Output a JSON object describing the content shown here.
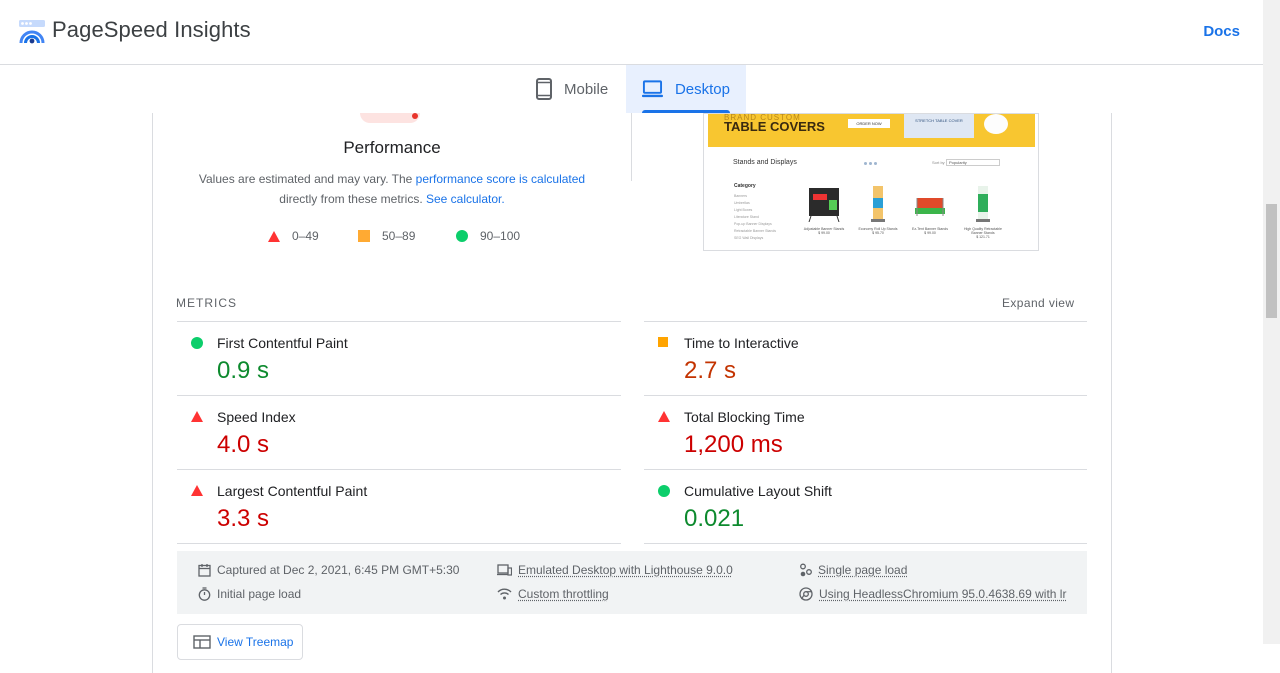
{
  "header": {
    "brand": "PageSpeed Insights",
    "docs_label": "Docs",
    "logo_icon": "pagespeed-logo-icon"
  },
  "tabs": [
    {
      "label": "Mobile",
      "icon": "mobile-phone-icon",
      "active": false
    },
    {
      "label": "Desktop",
      "icon": "laptop-icon",
      "active": true
    }
  ],
  "performance": {
    "title": "Performance",
    "desc_prefix": "Values are estimated and may vary. The ",
    "link_calculated": "performance score is calculated",
    "desc_middle": "directly from these metrics. ",
    "link_calculator": "See calculator.",
    "legend": [
      {
        "range": "0–49",
        "shape": "triangle",
        "color": "#ff3333"
      },
      {
        "range": "50–89",
        "shape": "square",
        "color": "#ffaa33"
      },
      {
        "range": "90–100",
        "shape": "circle",
        "color": "#0cce6b"
      }
    ]
  },
  "screenshot": {
    "banner_title": "TABLE COVERS",
    "banner_top": "BRAND CUSTOM",
    "banner_btn": "ORDER NOW",
    "banner_card": "STRETCH TABLE COVER",
    "section_title": "Stands and Displays",
    "sort_label": "Sort by",
    "sort_value": "Popularity",
    "category_title": "Category",
    "categories": [
      "Banners",
      "Umbrellas",
      "Light Boxes",
      "Literature Stand",
      "Pop-up Banner Displays",
      "Retractable Banner Stands",
      "SEG Wall Displays"
    ],
    "products": [
      {
        "name": "Adjustable Banner Stands",
        "price": "$ 99.00"
      },
      {
        "name": "Economy Roll Up Stands",
        "price": "$ 95.70"
      },
      {
        "name": "Ez-Tent Banner Stands",
        "price": "$ 99.00"
      },
      {
        "name": "High Quality Retractable Banner Stands",
        "price": "$ 121.71"
      }
    ]
  },
  "metrics": {
    "heading": "METRICS",
    "expand_label": "Expand view",
    "items": [
      {
        "label": "First Contentful Paint",
        "value": "0.9 s",
        "rating": "pass"
      },
      {
        "label": "Time to Interactive",
        "value": "2.7 s",
        "rating": "average"
      },
      {
        "label": "Speed Index",
        "value": "4.0 s",
        "rating": "fail"
      },
      {
        "label": "Total Blocking Time",
        "value": "1,200 ms",
        "rating": "fail"
      },
      {
        "label": "Largest Contentful Paint",
        "value": "3.3 s",
        "rating": "fail"
      },
      {
        "label": "Cumulative Layout Shift",
        "value": "0.021",
        "rating": "pass"
      }
    ]
  },
  "runtime": {
    "captured": "Captured at Dec 2, 2021, 6:45 PM GMT+5:30",
    "emulated": "Emulated Desktop with Lighthouse 9.0.0",
    "single_page": "Single page load",
    "initial_load": "Initial page load",
    "throttling": "Custom throttling",
    "browser": "Using HeadlessChromium 95.0.4638.69 with lr"
  },
  "treemap_label": "View Treemap",
  "colors": {
    "accent": "#1a73e8",
    "pass": "#0cce6b",
    "average": "#ffa400",
    "fail": "#ff4e42"
  }
}
